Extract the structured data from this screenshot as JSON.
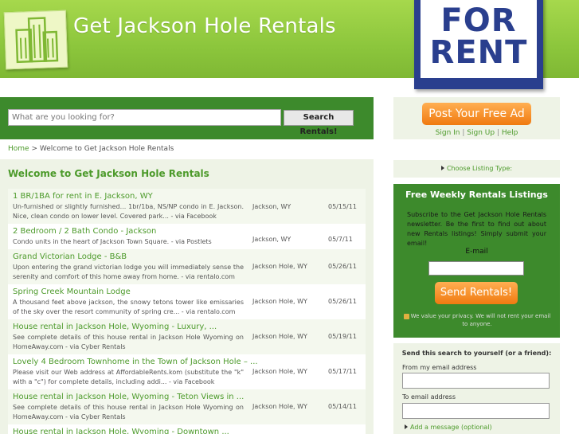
{
  "header": {
    "site_title": "Get Jackson Hole Rentals",
    "sign_word_1": "FOR",
    "sign_word_2": "RENT"
  },
  "search": {
    "placeholder": "What are you looking for?",
    "button_label": "Search Rentals!"
  },
  "breadcrumb": {
    "home": "Home",
    "separator": " > ",
    "current": "Welcome to Get Jackson Hole Rentals"
  },
  "main": {
    "heading": "Welcome to Get Jackson Hole Rentals",
    "listings": [
      {
        "title": "1 BR/1BA for rent in E. Jackson, WY",
        "desc": "Un-furnished or slightly furnished... 1br/1ba, NS/NP condo in E. Jackson. Nice, clean condo on lower level. Covered park... - via Facebook",
        "location": "Jackson, WY",
        "date": "05/15/11"
      },
      {
        "title": "2 Bedroom / 2 Bath Condo - Jackson",
        "desc": "Condo units in the heart of Jackson Town Square. - via Postlets",
        "location": "Jackson, WY",
        "date": "05/7/11"
      },
      {
        "title": "Grand Victorian Lodge - B&B",
        "desc": "Upon entering the grand victorian lodge you will immediately sense the serenity and comfort of this home away from home. - via rentalo.com",
        "location": "Jackson Hole, WY",
        "date": "05/26/11"
      },
      {
        "title": "Spring Creek Mountain Lodge",
        "desc": "A thousand feet above jackson, the snowy tetons tower like emissaries of the sky over the resort community of spring cre... - via rentalo.com",
        "location": "Jackson Hole, WY",
        "date": "05/26/11"
      },
      {
        "title": "House rental in Jackson Hole, Wyoming - Luxury, ...",
        "desc": "See complete details of this house rental in Jackson Hole Wyoming on HomeAway.com - via Cyber Rentals",
        "location": "Jackson Hole, WY",
        "date": "05/19/11"
      },
      {
        "title": "Lovely 4 Bedroom Townhome in the Town of Jackson Hole – ...",
        "desc": "Please visit our Web address at AffordableRents.kom (substitute the \"k\" with a \"c\") for complete details, including addi... - via Facebook",
        "location": "Jackson Hole, WY",
        "date": "05/17/11"
      },
      {
        "title": "House rental in Jackson Hole, Wyoming - Teton Views in ...",
        "desc": "See complete details of this house rental in Jackson Hole Wyoming on HomeAway.com - via Cyber Rentals",
        "location": "Jackson Hole, WY",
        "date": "05/14/11"
      },
      {
        "title": "House rental in Jackson Hole, Wyoming - Downtown ...",
        "desc": "",
        "location": "",
        "date": ""
      }
    ]
  },
  "sidebar": {
    "post_button": "Post Your Free Ad",
    "sign_in": "Sign In",
    "sign_up": "Sign Up",
    "help": "Help",
    "link_separator": " | ",
    "choose_listing": "Choose Listing Type:",
    "free_title": "Free Weekly Rentals Listings",
    "free_text": "Subscribe to the Get Jackson Hole Rentals newsletter. Be the first to find out about new Rentals listings! Simply submit your email!",
    "email_label": "E-mail",
    "send_button": "Send Rentals!",
    "privacy_text": "We value your privacy. We will not rent your email to anyone.",
    "send_search_title": "Send this search to yourself (or a friend):",
    "from_label": "From my email address",
    "to_label": "To email address",
    "add_message": "Add a message (optional)"
  },
  "colors": {
    "header_green": "#8cc63c",
    "dark_green": "#3d8a2c",
    "link_green": "#4c9a2a",
    "orange": "#f07a10",
    "sign_blue": "#2a3f8e"
  }
}
